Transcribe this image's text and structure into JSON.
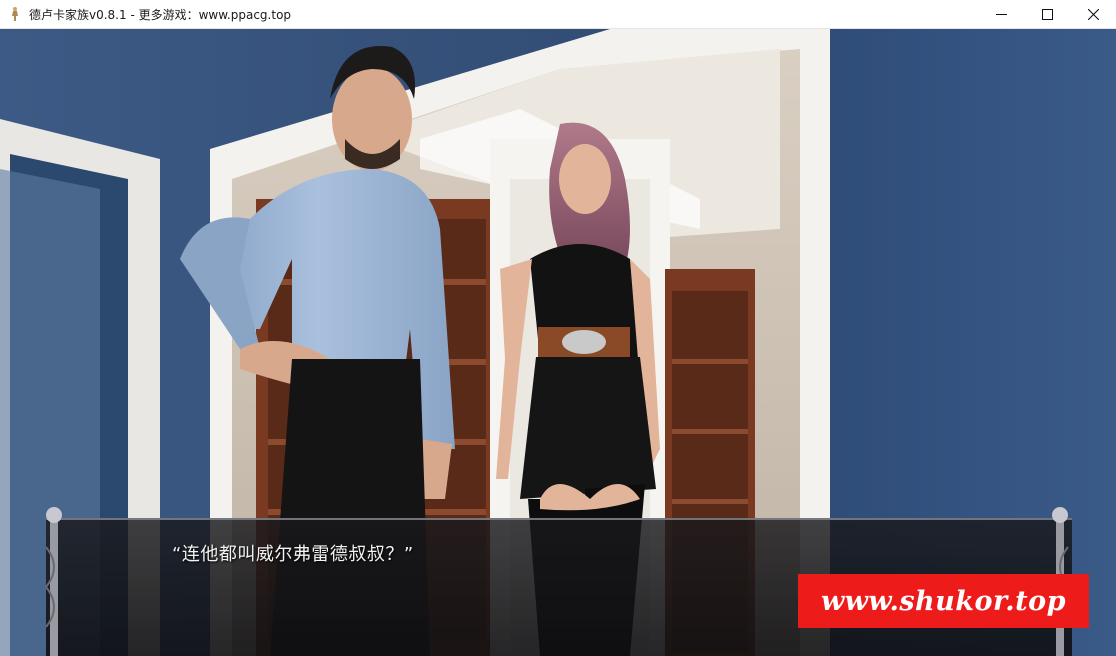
{
  "window": {
    "title": "德卢卡家族v0.8.1 - 更多游戏：www.ppacg.top",
    "icon": "figure-icon"
  },
  "dialogue": {
    "text": "“连他都叫威尔弗雷德叔叔？”"
  },
  "watermark": {
    "text": "www.shukor.top",
    "color": "#ee1b1b"
  },
  "colors": {
    "wall": "#2d4a73",
    "trim": "#f2f0ec",
    "shelf": "#7a3a22"
  }
}
